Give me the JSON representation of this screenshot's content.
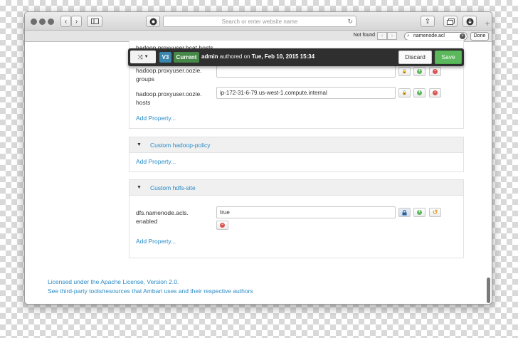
{
  "browser": {
    "url_placeholder": "Search or enter website name",
    "find_status": "Not found",
    "find_query": "namenode.acl",
    "done_label": "Done"
  },
  "versionbar": {
    "version_badge": "V3",
    "current_badge": "Current",
    "author": "admin",
    "authored_on_text": "authored on",
    "date": "Tue, Feb 10, 2015 15:34",
    "discard_label": "Discard",
    "save_label": "Save"
  },
  "top_panel": {
    "partial_label": "hadoop.proxyuser.hcat.hosts",
    "groups_label_line1": "hadoop.proxyuser.oozie.",
    "groups_label_line2": "groups",
    "hosts_label_line1": "hadoop.proxyuser.oozie.",
    "hosts_label_line2": "hosts",
    "hosts_value": "ip-172-31-6-79.us-west-1.compute.internal",
    "add_property": "Add Property..."
  },
  "policy_panel": {
    "title": "Custom hadoop-policy",
    "add_property": "Add Property..."
  },
  "hdfs_panel": {
    "title": "Custom hdfs-site",
    "label_line1": "dfs.namenode.acls.",
    "label_line2": "enabled",
    "value": "true",
    "add_property": "Add Property..."
  },
  "footer": {
    "license": "Licensed under the Apache License, Version 2.0.",
    "thirdparty": "See third-party tools/resources that Ambari uses and their respective authors"
  },
  "colors": {
    "link": "#2a8bc5",
    "version_badge": "#3a87ad",
    "current_badge": "#468847",
    "save": "#5cb85c",
    "remove": "#d9534f"
  }
}
